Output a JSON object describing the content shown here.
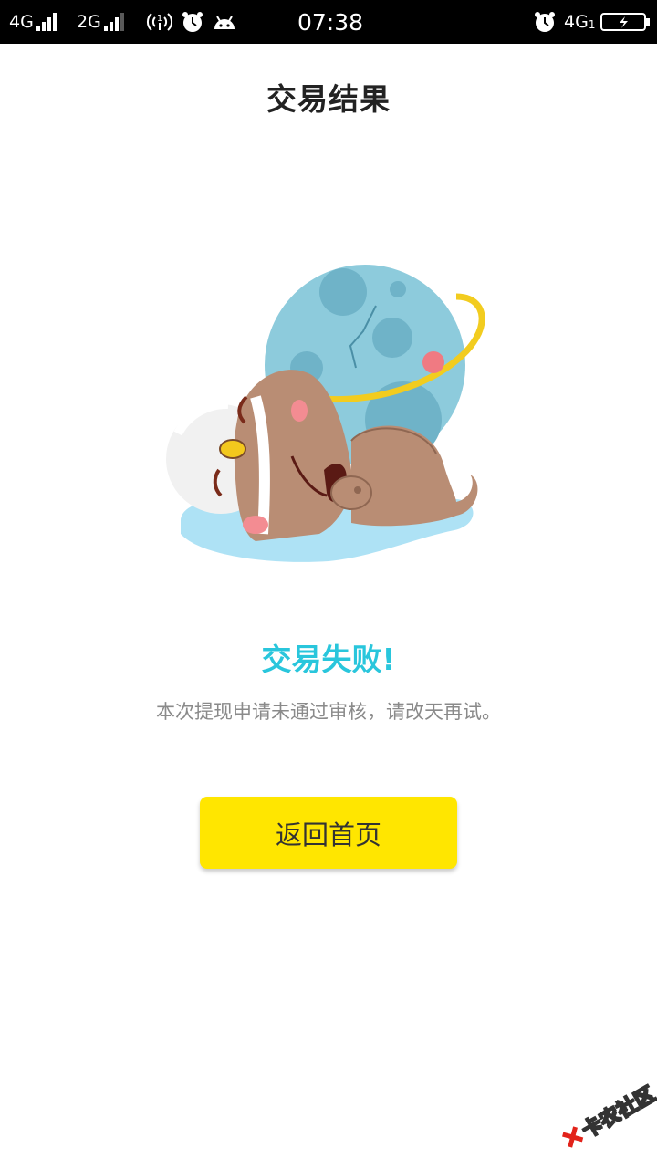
{
  "status_bar": {
    "sim1_network": "4G",
    "sim2_network": "2G",
    "hotspot_label": "1",
    "time": "07:38",
    "right_network": "4G",
    "right_network_sub": "1"
  },
  "page": {
    "title": "交易结果"
  },
  "result": {
    "title": "交易失败!",
    "message": "本次提现申请未通过审核，请改天再试。",
    "title_color": "#29c6dc"
  },
  "actions": {
    "home_button_label": "返回首页",
    "button_color": "#ffe600"
  },
  "watermark": {
    "text": "卡农社区",
    "logo_icon": "kanong-logo-icon"
  },
  "icons": {
    "signal": "signal-bars-icon",
    "hotspot": "hotspot-icon",
    "alarm": "alarm-clock-icon",
    "android": "android-icon",
    "battery": "battery-charging-icon"
  }
}
